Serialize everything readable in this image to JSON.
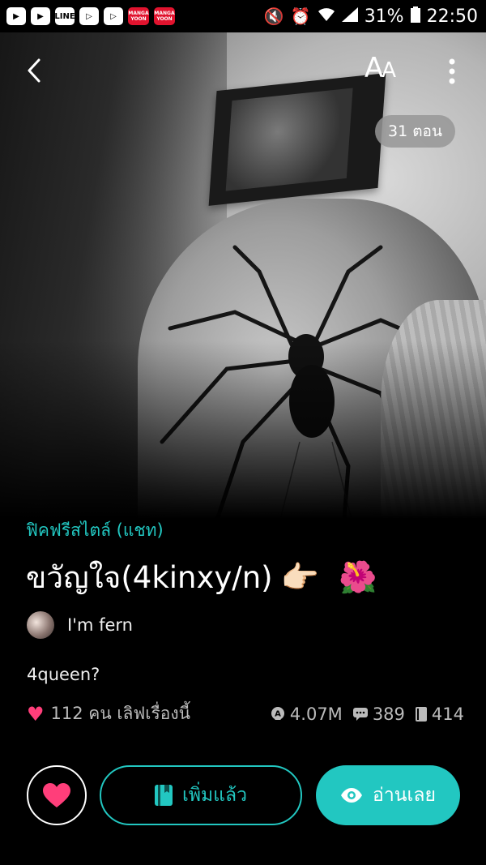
{
  "status_bar": {
    "notif_icons": [
      "app-icon",
      "app-icon",
      "LINE",
      "play-icon",
      "play-icon",
      "MANGA YOON",
      "MANGA YOON"
    ],
    "battery_percent": "31%",
    "time": "22:50"
  },
  "cover": {
    "font_button_big": "A",
    "font_button_small": "A",
    "episodes_badge": "31 ตอน"
  },
  "story": {
    "genre": "ฟิคฟรีสไตล์ (แชท)",
    "title": "ขวัญใจ(4kinxy/n)",
    "title_emojis": [
      "👉🏻",
      "🌺"
    ],
    "author": "I'm fern",
    "description": "4queen?",
    "likes_text": "112 คน เลิฟเรื่องนี้",
    "views": "4.07M",
    "comments": "389",
    "bookmarks": "414"
  },
  "actions": {
    "added_label": "เพิ่มแล้ว",
    "read_label": "อ่านเลย"
  },
  "colors": {
    "accent": "#22c7c1",
    "heart": "#ff3e7a"
  }
}
